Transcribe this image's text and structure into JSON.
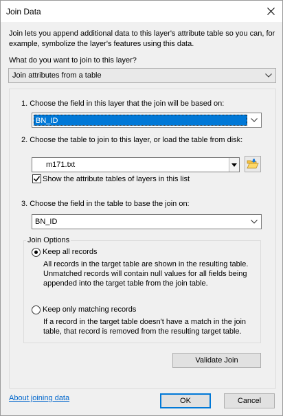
{
  "window": {
    "title": "Join Data"
  },
  "description": "Join lets you append additional data to this layer's attribute table so you can, for example, symbolize the layer's features using this data.",
  "join_type": {
    "question": "What do you want to join to this layer?",
    "selected": "Join attributes from a table"
  },
  "step1": {
    "label": "1.  Choose the field in this layer that the join will be based on:",
    "selected": "BN_ID"
  },
  "step2": {
    "label": "2.  Choose the table to join to this layer, or load the table from disk:",
    "table_value": "m171.txt",
    "show_attr_checkbox_label": "Show the attribute tables of layers in this list",
    "show_attr_checked": true
  },
  "step3": {
    "label": "3.  Choose the field in the table to base the join on:",
    "selected": "BN_ID"
  },
  "join_options": {
    "legend": "Join Options",
    "keep_all": {
      "label": "Keep all records",
      "description": "All records in the target table are shown in the resulting table. Unmatched records will contain null values for all fields being appended into the target table from the join table.",
      "selected": true
    },
    "keep_matching": {
      "label": "Keep only matching records",
      "description": "If a record in the target table doesn't have a match in the join table, that record is removed from the resulting target table.",
      "selected": false
    }
  },
  "buttons": {
    "validate": "Validate Join",
    "ok": "OK",
    "cancel": "Cancel"
  },
  "about_link": "About joining data",
  "icons": {
    "close": "close-icon",
    "dropdown": "chevron-down-icon",
    "folder": "folder-open-icon"
  }
}
